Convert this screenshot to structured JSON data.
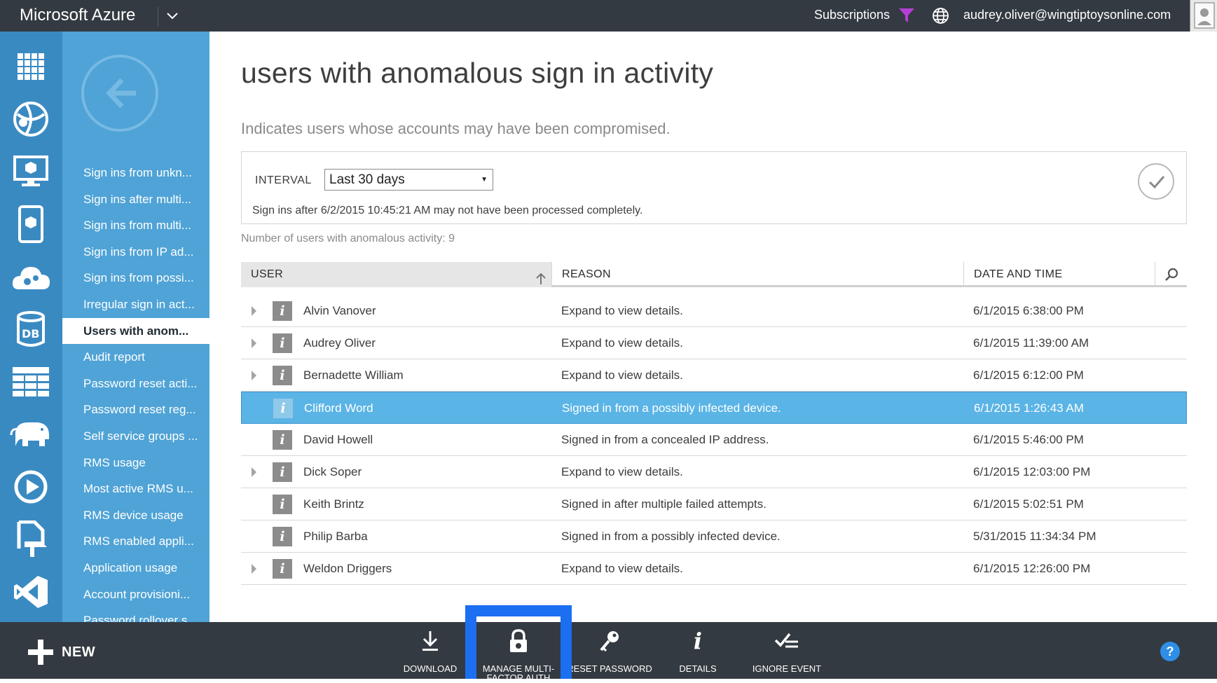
{
  "topbar": {
    "brand": "Microsoft Azure",
    "subscriptions": "Subscriptions",
    "user_email": "audrey.oliver@wingtiptoysonline.com"
  },
  "rail": {
    "icons": [
      "all-items-icon",
      "web-sites-icon",
      "virtual-machines-icon",
      "mobile-services-icon",
      "cloud-services-icon",
      "sql-databases-icon",
      "storage-icon",
      "hdinsight-icon",
      "media-services-icon",
      "biztalk-icon",
      "visual-studio-icon"
    ]
  },
  "nav": {
    "items": [
      {
        "label": "Sign ins from unkn...",
        "active": false
      },
      {
        "label": "Sign ins after multi...",
        "active": false
      },
      {
        "label": "Sign ins from multi...",
        "active": false
      },
      {
        "label": "Sign ins from IP ad...",
        "active": false
      },
      {
        "label": "Sign ins from possi...",
        "active": false
      },
      {
        "label": "Irregular sign in act...",
        "active": false
      },
      {
        "label": "Users with anom...",
        "active": true
      },
      {
        "label": "Audit report",
        "active": false
      },
      {
        "label": "Password reset acti...",
        "active": false
      },
      {
        "label": "Password reset reg...",
        "active": false
      },
      {
        "label": "Self service groups ...",
        "active": false
      },
      {
        "label": "RMS usage",
        "active": false
      },
      {
        "label": "Most active RMS u...",
        "active": false
      },
      {
        "label": "RMS device usage",
        "active": false
      },
      {
        "label": "RMS enabled appli...",
        "active": false
      },
      {
        "label": "Application usage",
        "active": false
      },
      {
        "label": "Account provisioni...",
        "active": false
      },
      {
        "label": "Password rollover s...",
        "active": false
      }
    ]
  },
  "main": {
    "title": "users with anomalous sign in activity",
    "subtitle": "Indicates users whose accounts may have been compromised.",
    "interval_label": "INTERVAL",
    "interval_value": "Last 30 days",
    "notice": "Sign ins after 6/2/2015 10:45:21 AM may not have been processed completely.",
    "count_text": "Number of users with anomalous activity: 9"
  },
  "table": {
    "columns": [
      "USER",
      "REASON",
      "DATE AND TIME"
    ],
    "rows": [
      {
        "user": "Alvin Vanover",
        "reason": "Expand to view details.",
        "date": "6/1/2015 6:38:00 PM",
        "expandable": true,
        "selected": false
      },
      {
        "user": "Audrey Oliver",
        "reason": "Expand to view details.",
        "date": "6/1/2015 11:39:00 AM",
        "expandable": true,
        "selected": false
      },
      {
        "user": "Bernadette William",
        "reason": "Expand to view details.",
        "date": "6/1/2015 6:12:00 PM",
        "expandable": true,
        "selected": false
      },
      {
        "user": "Clifford Word",
        "reason": "Signed in from a possibly infected device.",
        "date": "6/1/2015 1:26:43 AM",
        "expandable": false,
        "selected": true
      },
      {
        "user": "David Howell",
        "reason": "Signed in from a concealed IP address.",
        "date": "6/1/2015 5:46:00 PM",
        "expandable": false,
        "selected": false
      },
      {
        "user": "Dick Soper",
        "reason": "Expand to view details.",
        "date": "6/1/2015 12:03:00 PM",
        "expandable": true,
        "selected": false
      },
      {
        "user": "Keith Brintz",
        "reason": "Signed in after multiple failed attempts.",
        "date": "6/1/2015 5:02:51 PM",
        "expandable": false,
        "selected": false
      },
      {
        "user": "Philip Barba",
        "reason": "Signed in from a possibly infected device.",
        "date": "5/31/2015 11:34:34 PM",
        "expandable": false,
        "selected": false
      },
      {
        "user": "Weldon Driggers",
        "reason": "Expand to view details.",
        "date": "6/1/2015 12:26:00 PM",
        "expandable": true,
        "selected": false
      }
    ]
  },
  "bottombar": {
    "new_label": "NEW",
    "commands": [
      {
        "label": "DOWNLOAD",
        "icon": "download-icon"
      },
      {
        "label": "MANAGE MULTI-FACTOR AUTH",
        "icon": "lock-icon"
      },
      {
        "label": "RESET PASSWORD",
        "icon": "key-icon"
      },
      {
        "label": "DETAILS",
        "icon": "info-icon"
      },
      {
        "label": "IGNORE EVENT",
        "icon": "ignore-icon"
      }
    ],
    "help": "?"
  },
  "colors": {
    "topbar": "#343a41",
    "rail": "#3a8ac2",
    "nav": "#4fa3d6",
    "selected_row": "#5ab4e6",
    "highlight_box": "#1b6ff0",
    "filter_icon": "#b43fd6"
  }
}
